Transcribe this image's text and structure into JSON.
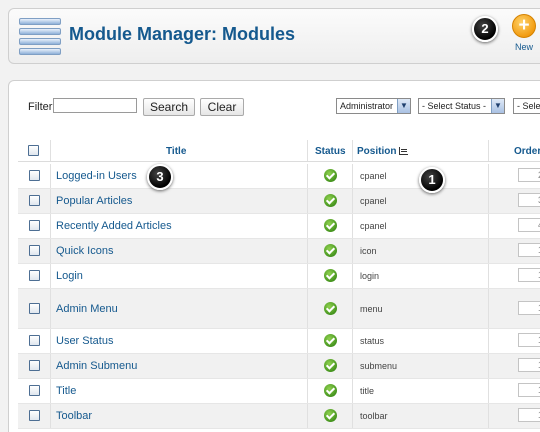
{
  "header": {
    "title": "Module Manager: Modules",
    "new_label": "New",
    "new_symbol": "+"
  },
  "callouts": [
    "1",
    "2",
    "3"
  ],
  "filter": {
    "label": "Filter:",
    "value": "",
    "search_label": "Search",
    "clear_label": "Clear",
    "client_select": "Administrator",
    "status_select": "- Select Status -",
    "third_select": "- Sele"
  },
  "table": {
    "columns": {
      "title": "Title",
      "status": "Status",
      "position": "Position",
      "order": "Order"
    },
    "rows": [
      {
        "title": "Logged-in Users",
        "position": "cpanel",
        "order": "2",
        "published": true
      },
      {
        "title": "Popular Articles",
        "position": "cpanel",
        "order": "3",
        "published": true
      },
      {
        "title": "Recently Added Articles",
        "position": "cpanel",
        "order": "4",
        "published": true
      },
      {
        "title": "Quick Icons",
        "position": "icon",
        "order": "1",
        "published": true
      },
      {
        "title": "Login",
        "position": "login",
        "order": "1",
        "published": true
      },
      {
        "title": "Admin Menu",
        "position": "menu",
        "order": "1",
        "published": true
      },
      {
        "title": "User Status",
        "position": "status",
        "order": "1",
        "published": true
      },
      {
        "title": "Admin Submenu",
        "position": "submenu",
        "order": "1",
        "published": true
      },
      {
        "title": "Title",
        "position": "title",
        "order": "1",
        "published": true
      },
      {
        "title": "Toolbar",
        "position": "toolbar",
        "order": "1",
        "published": true
      }
    ]
  },
  "colors": {
    "link": "#15598e",
    "accent_orange": "#f29c12",
    "status_green": "#3f8f1a"
  },
  "icons": {
    "module": "module-manager-icon",
    "new": "add-circle-icon",
    "status": "published-check-icon",
    "sort": "sort-icon"
  }
}
